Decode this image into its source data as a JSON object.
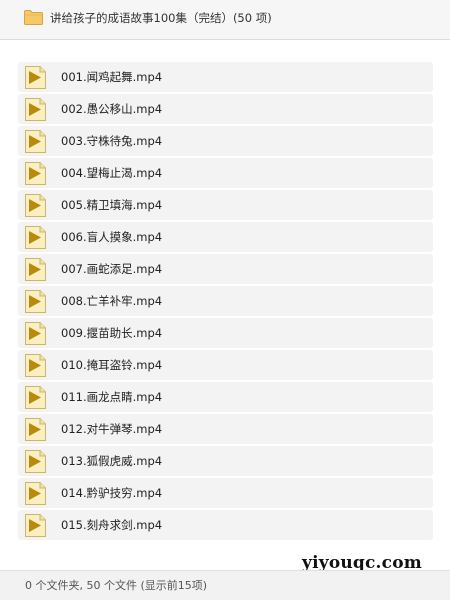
{
  "window": {
    "title": "讲给孩子的成语故事100集（完结）(50 项)",
    "folder_icon": "folder-icon"
  },
  "files": [
    {
      "name": "001.闻鸡起舞.mp4",
      "icon": "video-file-icon"
    },
    {
      "name": "002.愚公移山.mp4",
      "icon": "video-file-icon"
    },
    {
      "name": "003.守株待兔.mp4",
      "icon": "video-file-icon"
    },
    {
      "name": "004.望梅止渴.mp4",
      "icon": "video-file-icon"
    },
    {
      "name": "005.精卫填海.mp4",
      "icon": "video-file-icon"
    },
    {
      "name": "006.盲人摸象.mp4",
      "icon": "video-file-icon"
    },
    {
      "name": "007.画蛇添足.mp4",
      "icon": "video-file-icon"
    },
    {
      "name": "008.亡羊补牢.mp4",
      "icon": "video-file-icon"
    },
    {
      "name": "009.揠苗助长.mp4",
      "icon": "video-file-icon"
    },
    {
      "name": "010.掩耳盗铃.mp4",
      "icon": "video-file-icon"
    },
    {
      "name": "011.画龙点睛.mp4",
      "icon": "video-file-icon"
    },
    {
      "name": "012.对牛弹琴.mp4",
      "icon": "video-file-icon"
    },
    {
      "name": "013.狐假虎威.mp4",
      "icon": "video-file-icon"
    },
    {
      "name": "014.黔驴技穷.mp4",
      "icon": "video-file-icon"
    },
    {
      "name": "015.刻舟求剑.mp4",
      "icon": "video-file-icon"
    }
  ],
  "status_bar": {
    "text": "0 个文件夹, 50 个文件 (显示前15项)"
  },
  "watermark": "yiyouqc.com",
  "colors": {
    "folder": "#f5c869",
    "file_icon_bg": "#f9efc0",
    "play_triangle": "#b88a10",
    "row_bg": "#f3f3f3"
  }
}
